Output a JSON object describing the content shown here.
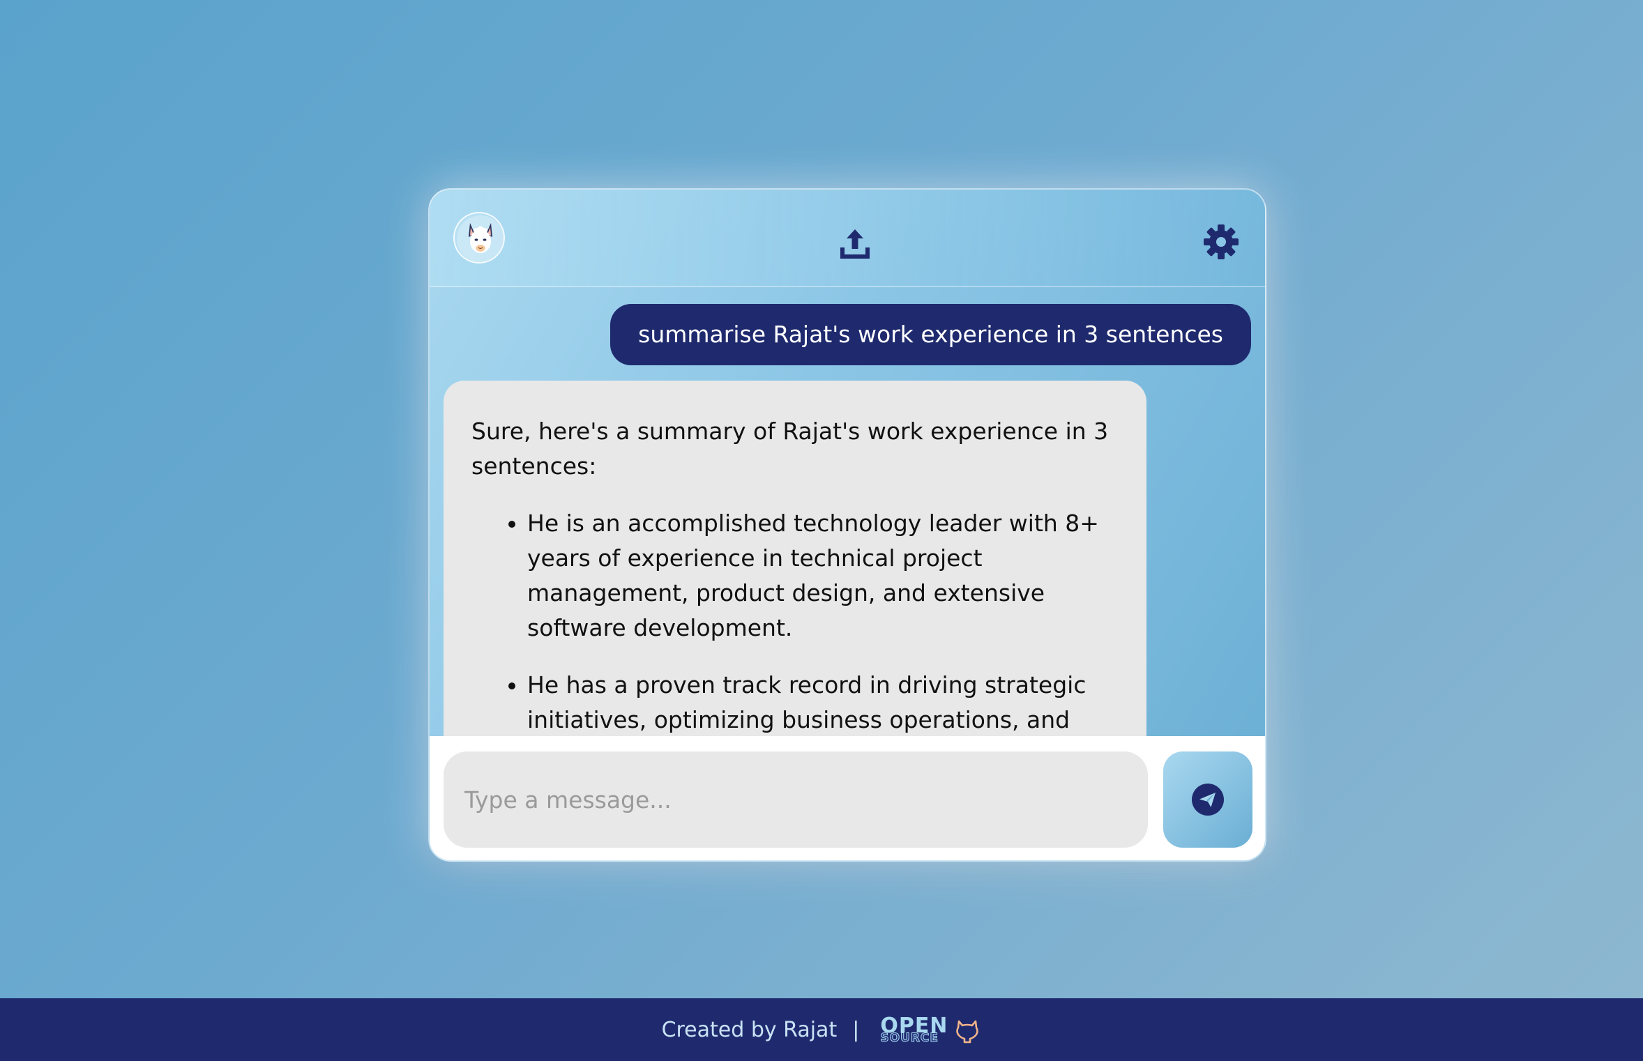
{
  "header": {
    "avatar_icon": "llama-avatar-icon",
    "upload_icon": "upload-icon",
    "settings_icon": "gear-icon"
  },
  "messages": {
    "user_message": "summarise Rajat's work experience in 3 sentences",
    "bot_intro": "Sure, here's a summary of Rajat's work experience in 3 sentences:",
    "bot_points": [
      "He is an accomplished technology leader with 8+ years of experience in technical project management, product design, and extensive software development.",
      "He has a proven track record in driving strategic initiatives, optimizing business operations, and"
    ]
  },
  "input": {
    "placeholder": "Type a message...",
    "value": "",
    "send_icon": "send-icon"
  },
  "footer": {
    "credit": "Created by Rajat",
    "separator": "|",
    "badge_top": "OPEN",
    "badge_bottom": "SOURCE",
    "badge_icon": "github-icon"
  },
  "colors": {
    "primary_navy": "#1f2a6e",
    "accent_light_blue": "#a9d8ef",
    "bubble_gray": "#e8e8e8",
    "background_blue": "#5aa3cc"
  }
}
